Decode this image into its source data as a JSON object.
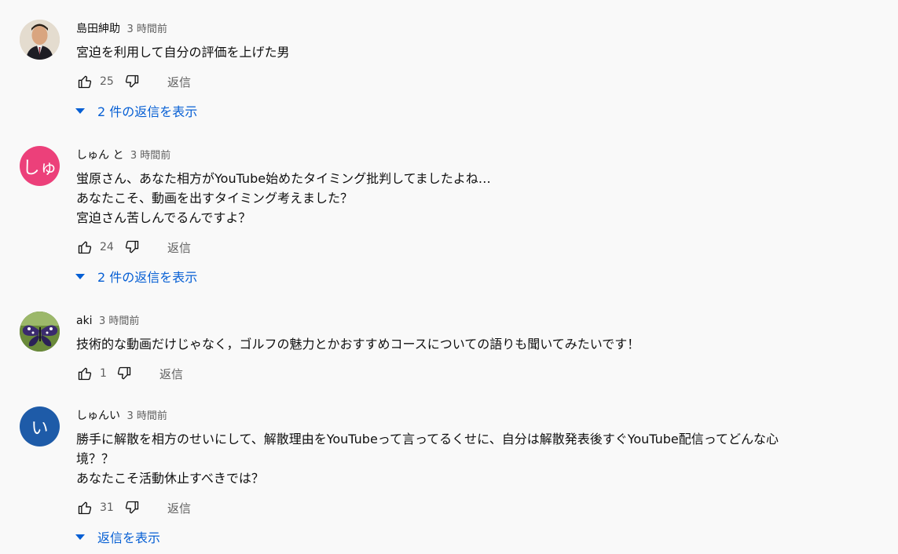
{
  "comments": [
    {
      "author": "島田紳助",
      "time": "3 時間前",
      "lines": [
        "宮迫を利用して自分の評価を上げた男"
      ],
      "likes": "25",
      "reply_label": "返信",
      "expand_label": "2 件の返信を表示",
      "avatar": {
        "type": "photo",
        "color": "#c7b9a3"
      }
    },
    {
      "author": "しゅん と",
      "time": "3 時間前",
      "lines": [
        "蛍原さん、あなた相方がYouTube始めたタイミング批判してましたよね…",
        "あなたこそ、動画を出すタイミング考えました？",
        "宮迫さん苦しんでるんですよ？"
      ],
      "likes": "24",
      "reply_label": "返信",
      "expand_label": "2 件の返信を表示",
      "avatar": {
        "type": "letter",
        "letter": "しゅ",
        "color": "#ec407a"
      }
    },
    {
      "author": "aki",
      "time": "3 時間前",
      "lines": [
        "技術的な動画だけじゃなく，ゴルフの魅力とかおすすめコースについての語りも聞いてみたいです！"
      ],
      "likes": "1",
      "reply_label": "返信",
      "expand_label": "",
      "avatar": {
        "type": "butterfly",
        "color": "#4a6b2a"
      }
    },
    {
      "author": "しゅんい",
      "time": "3 時間前",
      "lines": [
        "勝手に解散を相方のせいにして、解散理由をYouTubeって言ってるくせに、自分は解散発表後すぐYouTube配信ってどんな心",
        "境？？",
        "あなたこそ活動休止すべきでは？"
      ],
      "likes": "31",
      "reply_label": "返信",
      "expand_label": "返信を表示",
      "avatar": {
        "type": "letter",
        "letter": "い",
        "color": "#1e5ba8"
      }
    }
  ],
  "icons": {
    "like": "thumbs-up-icon",
    "dislike": "thumbs-down-icon",
    "expand": "caret-down-icon"
  },
  "colors": {
    "link": "#065fd4",
    "secondary_text": "#606060",
    "background": "#f9f9f9"
  }
}
